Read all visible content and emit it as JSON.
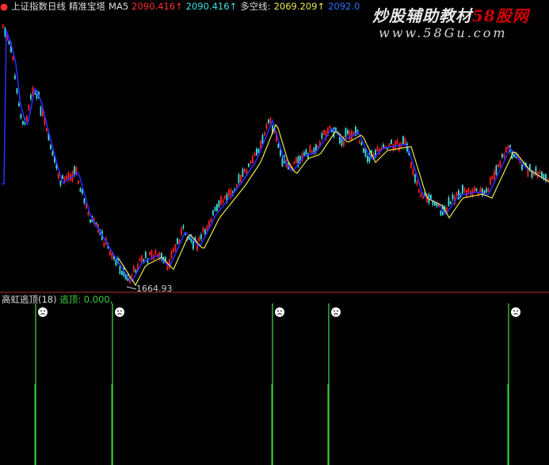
{
  "header": {
    "title": "上证指数日线",
    "indicator": "精准宝塔",
    "ma_label": "MA5",
    "ma_value": "2090.416↑",
    "ma_value2": "2090.416↑",
    "multi_label": "多空线:",
    "multi_value": "2069.209↑",
    "extra_value": "2092.0"
  },
  "watermark": {
    "cn_white": "炒股辅助教材",
    "cn_red": "58股网",
    "url": "www.58Gu.com"
  },
  "main_chart": {
    "low_label": "1664.93",
    "colors": {
      "up": "#ff2020",
      "down": "#40e0e0",
      "ma": "#2a2aff",
      "multi": "#e8e850",
      "grid": "#b03030"
    }
  },
  "indicator": {
    "name": "高虹逃顶(18)",
    "signal_label": "逃顶:",
    "signal_value": "0.000,",
    "signal_color": "#3cd23c",
    "face_icon": "frown-face-icon",
    "spike_count": 5
  }
}
